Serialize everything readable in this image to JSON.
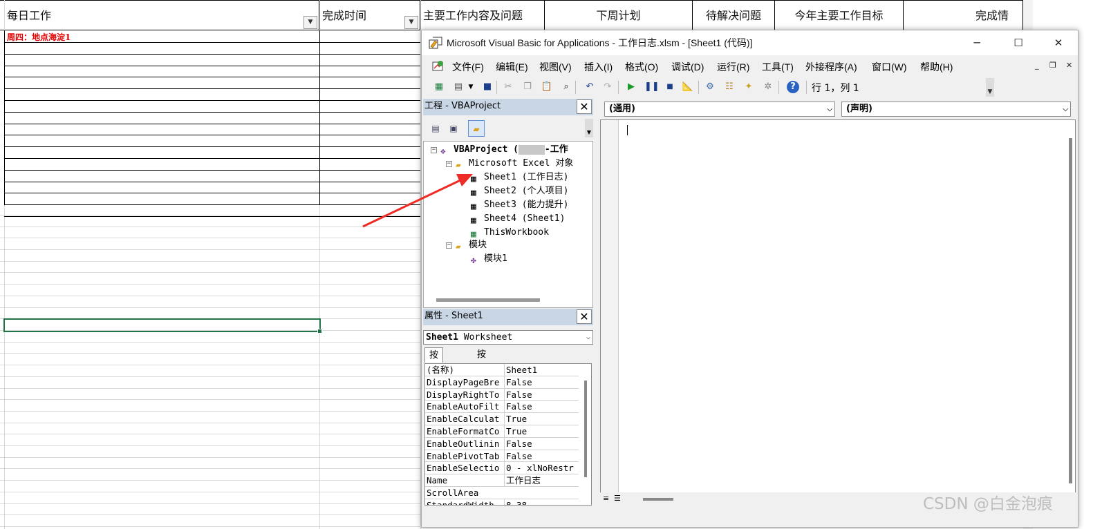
{
  "excel": {
    "headers": [
      {
        "label": "每日工作"
      },
      {
        "label": "完成时间"
      },
      {
        "label": "主要工作内容及问题"
      },
      {
        "label": "下周计划"
      },
      {
        "label": "待解决问题"
      },
      {
        "label": "今年主要工作目标"
      },
      {
        "label": "完成情"
      }
    ],
    "red_note": "周四：地点海淀1"
  },
  "vba": {
    "title": "Microsoft Visual Basic for Applications - 工作日志.xlsm - [Sheet1 (代码)]",
    "window_buttons": {
      "minimize": "─",
      "maximize": "☐",
      "close": "✕"
    },
    "menu": [
      "文件(F)",
      "编辑(E)",
      "视图(V)",
      "插入(I)",
      "格式(O)",
      "调试(D)",
      "运行(R)",
      "工具(T)",
      "外接程序(A)",
      "窗口(W)",
      "帮助(H)"
    ],
    "mdi": {
      "minimize": "_",
      "restore": "❐",
      "close": "✕"
    },
    "cursor_position": "行 1，列 1",
    "project_pane": {
      "title": "工程 - VBAProject",
      "close_label": "✕",
      "tree": {
        "root": "VBAProject (工作日志.xlsm)",
        "root_visible": "VBAProject (",
        "root_tail": "-工作",
        "folder_objects": "Microsoft Excel 对象",
        "items": [
          "Sheet1 (工作日志)",
          "Sheet2 (个人项目)",
          "Sheet3 (能力提升)",
          "Sheet4 (Sheet1)",
          "ThisWorkbook"
        ],
        "folder_modules": "模块",
        "modules": [
          "模块1"
        ]
      }
    },
    "properties_pane": {
      "title": "属性 - Sheet1",
      "close_label": "✕",
      "object_bold": "Sheet1",
      "object_type": "Worksheet",
      "tabs": [
        "按字母序",
        "按分类序"
      ],
      "rows": [
        {
          "name": "(名称)",
          "value": "Sheet1"
        },
        {
          "name": "DisplayPageBre",
          "value": "False"
        },
        {
          "name": "DisplayRightTo",
          "value": "False"
        },
        {
          "name": "EnableAutoFilt",
          "value": "False"
        },
        {
          "name": "EnableCalculat",
          "value": "True"
        },
        {
          "name": "EnableFormatCo",
          "value": "True"
        },
        {
          "name": "EnableOutlinin",
          "value": "False"
        },
        {
          "name": "EnablePivotTab",
          "value": "False"
        },
        {
          "name": "EnableSelectio",
          "value": "0 - xlNoRestr"
        },
        {
          "name": "Name",
          "value": "工作日志"
        },
        {
          "name": "ScrollArea",
          "value": ""
        },
        {
          "name": "StandardWidth",
          "value": "8.38"
        }
      ]
    },
    "code_pane": {
      "object_combo": "(通用)",
      "proc_combo": "(声明)"
    }
  },
  "watermark": "CSDN @白金泡痕",
  "colors": {
    "selection_green": "#217346",
    "annotation_red": "#ee2b24",
    "pane_title_bg": "#c9d6e6"
  }
}
